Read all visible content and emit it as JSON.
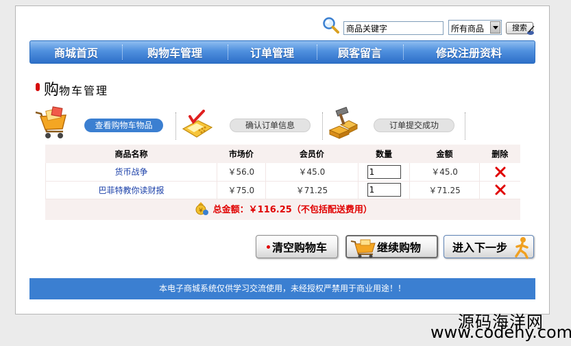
{
  "search": {
    "value": "商品关键字",
    "category": "所有商品",
    "button": "搜索",
    "icons": [
      "magnifier-icon",
      "pen-icon"
    ]
  },
  "nav": {
    "items": [
      {
        "label": "商城首页"
      },
      {
        "label": "购物车管理"
      },
      {
        "label": "订单管理"
      },
      {
        "label": "顾客留言"
      },
      {
        "label": "修改注册资料"
      }
    ]
  },
  "page_title": {
    "first": "购",
    "rest": "物车管理"
  },
  "steps": [
    {
      "label": "查看购物车物品",
      "active": true,
      "icon": "shopping-cart-icon"
    },
    {
      "label": "确认订单信息",
      "active": false,
      "icon": "calculator-check-icon"
    },
    {
      "label": "订单提交成功",
      "active": false,
      "icon": "boxes-hammer-icon"
    }
  ],
  "cart": {
    "headers": [
      "商品名称",
      "市场价",
      "会员价",
      "数量",
      "金额",
      "删除"
    ],
    "rows": [
      {
        "name": "货币战争",
        "market": "￥56.0",
        "member": "￥45.0",
        "qty": "1",
        "amount": "￥45.0"
      },
      {
        "name": "巴菲特教你读财报",
        "market": "￥75.0",
        "member": "￥71.25",
        "qty": "1",
        "amount": "￥71.25"
      }
    ],
    "total": "总金额：￥116.25（不包括配送费用）"
  },
  "actions": {
    "clear": "清空购物车",
    "continue": "继续购物",
    "next": "进入下一步"
  },
  "footer": "本电子商城系统仅供学习交流使用，未经授权严禁用于商业用途！！",
  "watermark": {
    "line1": "源码海洋网",
    "line2": "www.codehy.com"
  },
  "colors": {
    "nav_blue": "#4f90de",
    "footer_blue": "#3b7fd1",
    "total_red": "#e00000",
    "link_blue": "#1a3fa8"
  }
}
